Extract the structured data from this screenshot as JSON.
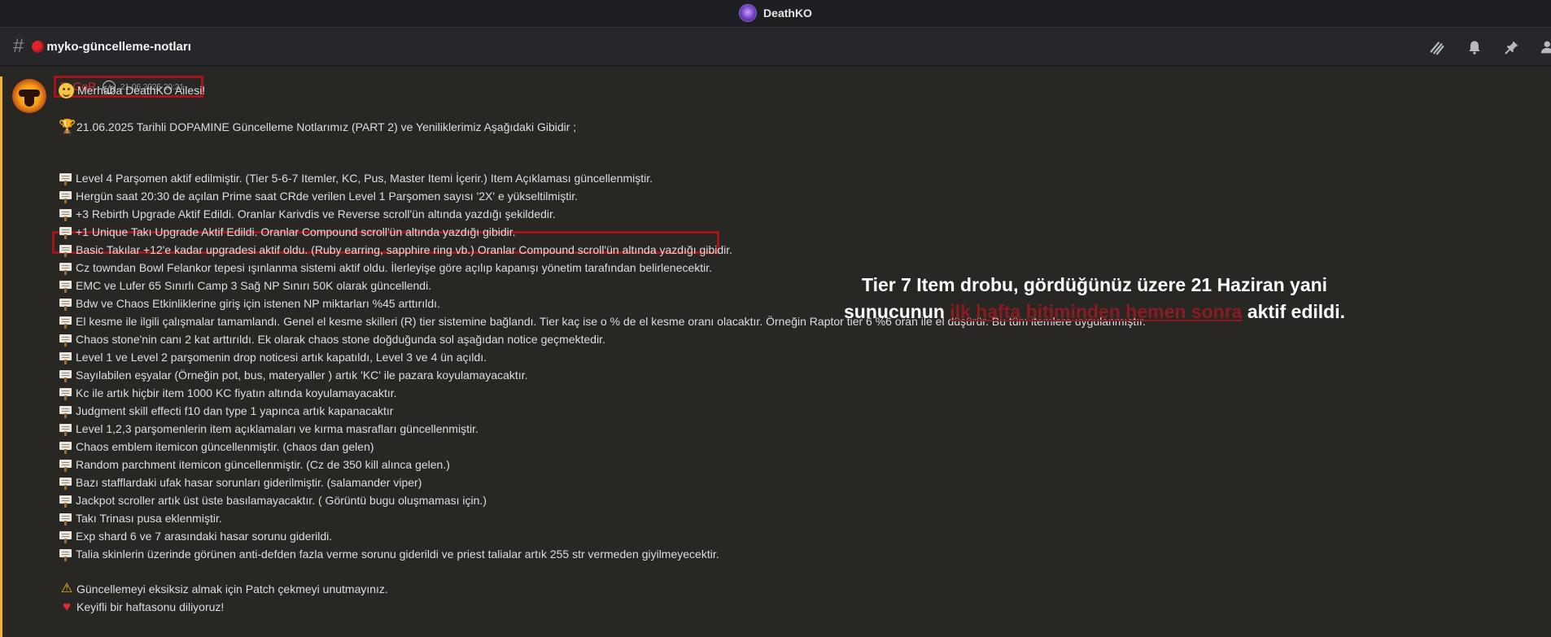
{
  "window": {
    "title": "DeathKO"
  },
  "channel": {
    "name": "myko-güncelleme-notları"
  },
  "message": {
    "author": "ZaGoR",
    "badge": "</>",
    "timestamp": "21.06.2025 20:21",
    "greeting": "Merhaba DeathKO Ailesi!",
    "heading": "21.06.2025 Tarihli DOPAMINE Güncelleme Notlarımız (PART 2) ve Yeniliklerimiz Aşağıdaki Gibidir ;",
    "items": [
      "Level 4 Parşomen aktif edilmiştir. (Tier 5-6-7 Itemler, KC, Pus, Master Itemi İçerir.)  Item Açıklaması güncellenmiştir.",
      "Hergün saat 20:30 de açılan Prime saat CRde verilen Level 1 Parşomen sayısı '2X' e yükseltilmiştir.",
      "+3 Rebirth Upgrade Aktif Edildi. Oranlar Karivdis ve Reverse scroll'ün altında yazdığı şekildedir.",
      "+1 Unique Takı Upgrade Aktif Edildi. Oranlar Compound scroll'ün altında yazdığı gibidir.",
      "Basic Takılar +12'e kadar upgradesi aktif oldu. (Ruby earring, sapphire ring vb.) Oranlar Compound scroll'ün altında yazdığı gibidir.",
      "Cz towndan Bowl Felankor tepesi ışınlanma sistemi aktif oldu. İlerleyişe göre açılıp kapanışı yönetim tarafından belirlenecektir.",
      "EMC ve Lufer 65 Sınırlı Camp 3 Sağ NP Sınırı 50K olarak güncellendi.",
      "Bdw ve Chaos Etkinliklerine giriş için istenen NP miktarları %45 arttırıldı.",
      "El kesme ile ilgili çalışmalar tamamlandı. Genel el kesme skilleri (R) tier sistemine bağlandı. Tier kaç ise o % de el kesme oranı olacaktır. Örneğin Raptor tier 6 %6 oran ile el düşürür. Bu tüm itemlere uygulanmıştır.",
      "Chaos stone'nin canı 2 kat arttırıldı. Ek olarak chaos stone doğduğunda sol aşağıdan notice geçmektedir.",
      "Level 1 ve Level 2 parşomenin drop noticesi artık kapatıldı, Level 3 ve 4 ün açıldı.",
      "Sayılabilen eşyalar (Örneğin pot, bus, materyaller ) artık 'KC' ile pazara koyulamayacaktır.",
      "Kc ile artık hiçbir item 1000 KC fiyatın altında koyulamayacaktır.",
      "Judgment skill effecti f10 dan type 1 yapınca artık kapanacaktır",
      "Level 1,2,3 parşomenlerin item açıklamaları ve kırma masrafları güncellenmiştir.",
      "Chaos emblem itemicon güncellenmiştir. (chaos dan gelen)",
      "Random parchment itemicon güncellenmiştir. (Cz de 350 kill alınca gelen.)",
      "Bazı stafflardaki ufak hasar sorunları giderilmiştir. (salamander  viper)",
      "Jackpot scroller artık üst üste basılamayacaktır. ( Görüntü bugu oluşmaması için.)",
      " Takı Trinası pusa eklenmiştir.",
      " Exp shard 6 ve 7 arasındaki hasar sorunu giderildi.",
      "Talia skinlerin üzerinde görünen anti-defden fazla verme sorunu giderildi ve priest talialar artık 255 str vermeden giyilmeyecektir."
    ],
    "footer_warning": "Güncellemeyi eksiksiz almak için Patch çekmeyi unutmayınız.",
    "footer_heart": "Keyifli bir haftasonu diliyoruz!"
  },
  "annotation": {
    "line1": "Tier 7 Item drobu, gördüğünüz üzere 21 Haziran yani",
    "line2_start": "sunucunun ",
    "line2_red": "ilk hafta bitiminden hemen sonra",
    "line2_end": " aktif edildi."
  },
  "colors": {
    "accent_red": "#a3151c",
    "author_red": "#d92a2a",
    "highlight_yellow": "#f0b232"
  },
  "icons": [
    "hash-icon",
    "threads-icon",
    "bell-icon",
    "pin-icon",
    "members-icon",
    "scroll-emoji-icon",
    "trophy-icon",
    "warning-icon",
    "heart-icon",
    "smile-icon"
  ]
}
